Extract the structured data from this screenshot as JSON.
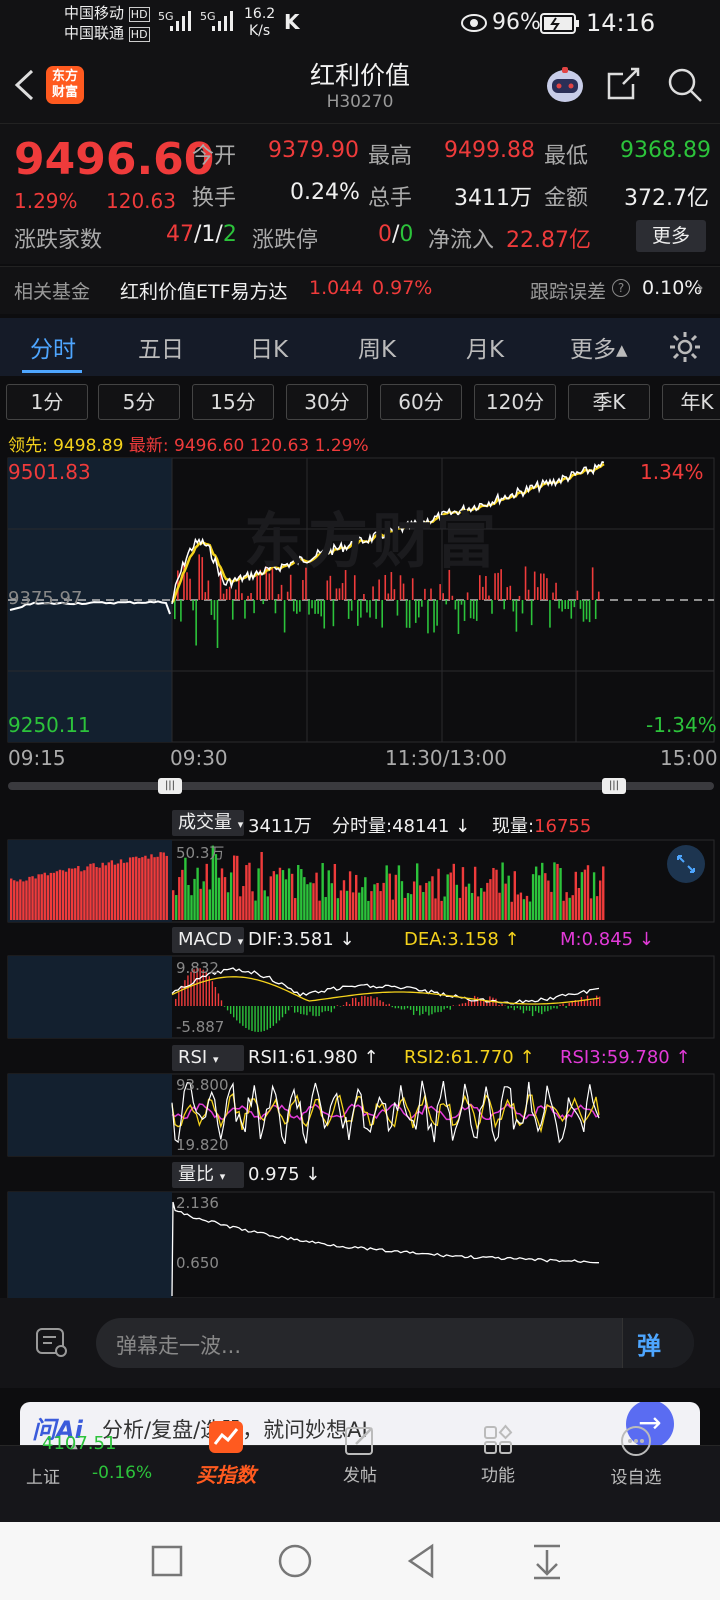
{
  "status_bar": {
    "carrier1": "中国移动",
    "carrier2": "中国联通",
    "hd": "HD",
    "net1": "5G",
    "net2": "5G",
    "speed_value": "16.2",
    "speed_unit": "K/s",
    "battery": "96%",
    "time": "14:16"
  },
  "header": {
    "logo_text_1": "东方",
    "logo_text_2": "财富",
    "title": "红利价值",
    "code": "H30270"
  },
  "quote": {
    "price": "9496.60",
    "change_pct": "1.29%",
    "change_abs": "120.63",
    "open_label": "今开",
    "open_value": "9379.90",
    "high_label": "最高",
    "high_value": "9499.88",
    "low_label": "最低",
    "low_value": "9368.89",
    "turnover_label": "换手",
    "turnover_value": "0.24%",
    "volume_label": "总手",
    "volume_value": "3411万",
    "amount_label": "金额",
    "amount_value": "372.7亿",
    "breadth_label": "涨跌家数",
    "breadth_up": "47",
    "breadth_flat": "1",
    "breadth_down": "2",
    "sep": "/",
    "limit_label": "涨跌停",
    "limit_up": "0",
    "limit_down": "0",
    "netflow_label": "净流入",
    "netflow_value": "22.87亿",
    "more_button": "更多"
  },
  "fund": {
    "label": "相关基金",
    "name": "红利价值ETF易方达",
    "price": "1.044",
    "pct": "0.97%",
    "tracking_label": "跟踪误差",
    "tracking_value": "0.10%"
  },
  "tabs": [
    "分时",
    "五日",
    "日K",
    "周K",
    "月K",
    "更多▴"
  ],
  "periods": [
    "1分",
    "5分",
    "15分",
    "30分",
    "60分",
    "120分",
    "季K",
    "年K"
  ],
  "chart_header": {
    "lead_label": "领先:",
    "lead_value": "9498.89",
    "latest_label": "最新:",
    "latest_value": "9496.60",
    "latest_change": "120.63",
    "latest_pct": "1.29%"
  },
  "chart_data": {
    "type": "line",
    "title": "",
    "ylim": [
      9250.11,
      9501.83
    ],
    "y_top_label": "9501.83",
    "y_bottom_label": "9250.11",
    "y_mid_label": "9375.97",
    "pct_top_label": "1.34%",
    "pct_bottom_label": "-1.34%",
    "x_ticks": [
      "09:15",
      "09:30",
      "11:30/13:00",
      "15:00"
    ],
    "watermark": "东方财富",
    "series": []
  },
  "volume": {
    "tag": "成交量",
    "total": "3411万",
    "minute_label": "分时量:",
    "minute_value": "48141",
    "now_label": "现量:",
    "now_value": "16755",
    "max_label": "50.3万"
  },
  "macd": {
    "tag": "MACD",
    "dif": "DIF:3.581",
    "dea": "DEA:3.158",
    "m": "M:0.845",
    "top": "9.832",
    "bottom": "-5.887"
  },
  "rsi": {
    "tag": "RSI",
    "rsi1": "RSI1:61.980",
    "rsi2": "RSI2:61.770",
    "rsi3": "RSI3:59.780",
    "top": "93.800",
    "bottom": "19.820"
  },
  "volratio": {
    "tag": "量比",
    "value": "0.975",
    "top": "2.136",
    "bottom": "0.650"
  },
  "danmu": {
    "placeholder": "弹幕走一波...",
    "button": "弹"
  },
  "ai": {
    "brand": "问Ai",
    "text": "分析/复盘/选股，就问妙想AI"
  },
  "bottom_nav": {
    "index_value": "4107.51",
    "index_name": "上证",
    "index_pct": "-0.16%",
    "items": [
      "买指数",
      "发帖",
      "功能",
      "设自选"
    ]
  },
  "colors": {
    "up": "#ef3b3b",
    "down": "#2cc33b",
    "accent": "#4ea6ff",
    "brand": "#ff5a1f"
  }
}
